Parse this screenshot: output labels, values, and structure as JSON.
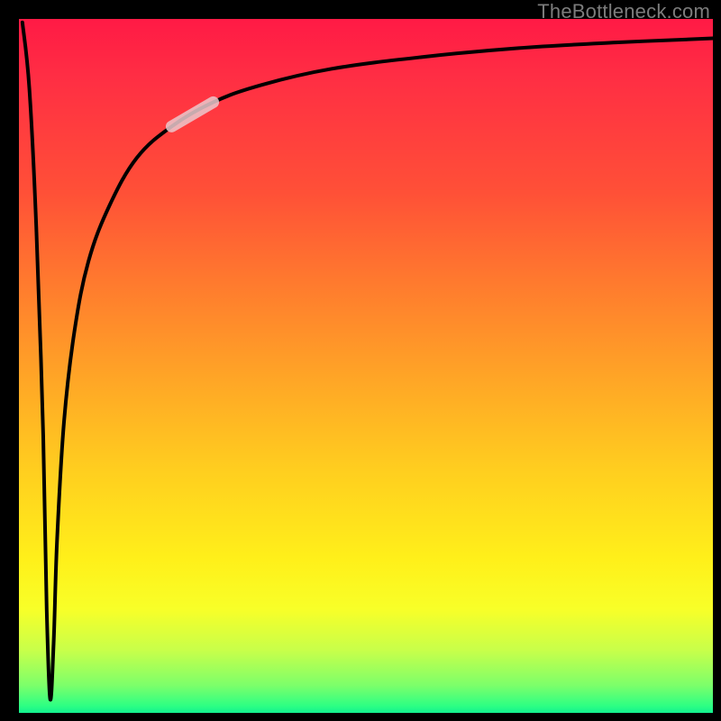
{
  "watermark": "TheBottleneck.com",
  "chart_data": {
    "type": "line",
    "title": "",
    "xlabel": "",
    "ylabel": "",
    "xlim": [
      0,
      100
    ],
    "ylim": [
      0,
      100
    ],
    "note": "Axes are unlabeled; x runs left→right, y runs bottom→top as percentage of plot area. The curve starts at top-left, dives steeply to a narrow valley near x≈4.5 reaching y≈2, then rises asymptotically toward y≈97 at the right edge. Background is a vertical red→yellow→green gradient. A short pale highlight segment overlays the curve around x≈22–28.",
    "series": [
      {
        "name": "bottleneck-curve",
        "x": [
          0.5,
          1.5,
          2.5,
          3.5,
          4.0,
          4.5,
          5.0,
          5.5,
          6.5,
          8.0,
          10.0,
          13.0,
          17.0,
          22.0,
          28.0,
          35.0,
          45.0,
          58.0,
          72.0,
          86.0,
          100.0
        ],
        "y": [
          99.5,
          90.0,
          70.0,
          40.0,
          15.0,
          2.0,
          10.0,
          25.0,
          42.0,
          55.0,
          65.0,
          73.0,
          80.0,
          84.5,
          88.0,
          90.5,
          92.8,
          94.5,
          95.8,
          96.6,
          97.2
        ]
      }
    ],
    "highlight_segment": {
      "x_start": 22.0,
      "x_end": 28.0
    }
  },
  "colors": {
    "curve": "#000000",
    "highlight": "rgba(235,200,205,0.85)",
    "frame": "#000000"
  }
}
